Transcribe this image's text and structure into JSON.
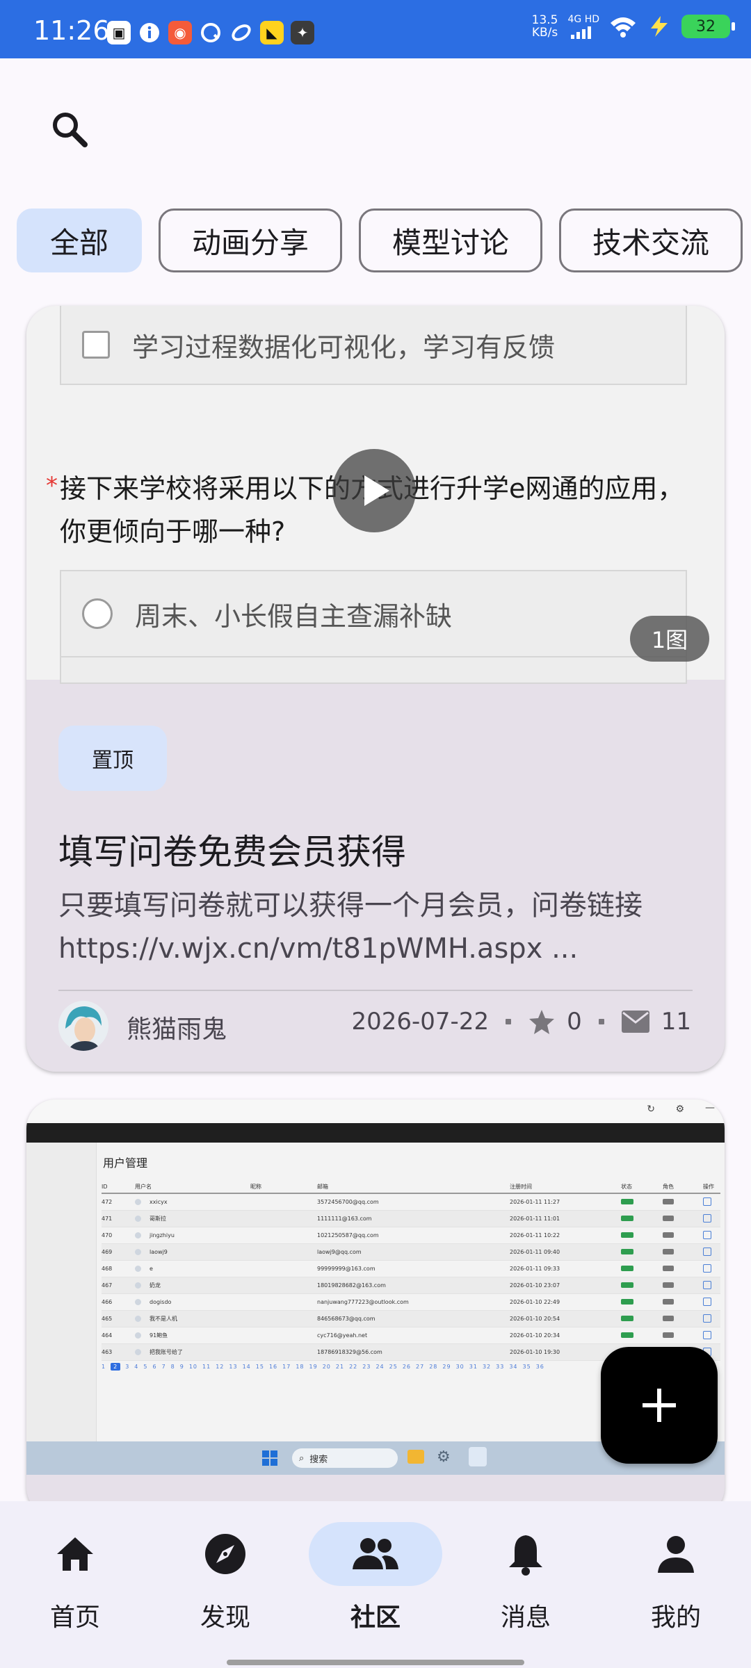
{
  "status_bar": {
    "time": "11:26",
    "net_speed_value": "13.5",
    "net_speed_unit": "KB/s",
    "network": "4G HD",
    "battery": "32"
  },
  "tabs": [
    "全部",
    "动画分享",
    "模型讨论",
    "技术交流"
  ],
  "post1": {
    "option_text_1": "学习过程数据化可视化，学习有反馈",
    "question_text": "接下来学校将采用以下的方式进行升学e网通的应用，你更倾向于哪一种?",
    "option_text_2": "周末、小长假自主查漏补缺",
    "image_count": "1图",
    "pin_label": "置顶",
    "title": "填写问卷免费会员获得",
    "body": "只要填写问卷就可以获得一个月会员，问卷链接https://v.wjx.cn/vm/t81pWMH.aspx ...",
    "author": "熊猫雨鬼",
    "date": "2026-07-22",
    "stars": "0",
    "comments": "11"
  },
  "post2": {
    "screenshot": {
      "page_title": "用户管理",
      "columns": [
        "ID",
        "用户名",
        "昵称",
        "邮箱",
        "注册时间",
        "状态",
        "角色",
        "操作"
      ],
      "rows": [
        {
          "id": "472",
          "user": "xxicyx",
          "mail": "3572456700@qq.com",
          "time": "2026-01-11 11:27"
        },
        {
          "id": "471",
          "user": "哥斯拉",
          "mail": "1111111@163.com",
          "time": "2026-01-11 11:01"
        },
        {
          "id": "470",
          "user": "jingzhiyu",
          "mail": "1021250587@qq.com",
          "time": "2026-01-11 10:22"
        },
        {
          "id": "469",
          "user": "laowj9",
          "mail": "laowj9@qq.com",
          "time": "2026-01-11 09:40"
        },
        {
          "id": "468",
          "user": "e",
          "mail": "99999999@163.com",
          "time": "2026-01-11 09:33"
        },
        {
          "id": "467",
          "user": "奶龙",
          "mail": "18019828682@163.com",
          "time": "2026-01-10 23:07"
        },
        {
          "id": "466",
          "user": "dogisdo",
          "mail": "nanjuwang777223@outlook.com",
          "time": "2026-01-10 22:49"
        },
        {
          "id": "465",
          "user": "我不是人机",
          "mail": "846568673@qq.com",
          "time": "2026-01-10 20:54"
        },
        {
          "id": "464",
          "user": "91鲍鱼",
          "mail": "cyc716@yeah.net",
          "time": "2026-01-10 20:34"
        },
        {
          "id": "463",
          "user": "把我账号给了",
          "mail": "18786918329@56.com",
          "time": "2026-01-10 19:30"
        }
      ],
      "pages": [
        "1",
        "2",
        "3",
        "4",
        "5",
        "6",
        "7",
        "8",
        "9",
        "10",
        "11",
        "12",
        "13",
        "14",
        "15",
        "16",
        "17",
        "18",
        "19",
        "20",
        "21",
        "22",
        "23",
        "24",
        "25",
        "26",
        "27",
        "28",
        "29",
        "30",
        "31",
        "32",
        "33",
        "34",
        "35",
        "36"
      ],
      "current_page": "2",
      "search_label": "搜索"
    }
  },
  "nav": [
    {
      "label": "首页",
      "icon": "home-icon"
    },
    {
      "label": "发现",
      "icon": "compass-icon"
    },
    {
      "label": "社区",
      "icon": "community-icon"
    },
    {
      "label": "消息",
      "icon": "bell-icon"
    },
    {
      "label": "我的",
      "icon": "person-icon"
    }
  ],
  "colors": {
    "status_bar": "#2c6ee3",
    "accent": "#d5e3fc",
    "card": "#e6e0e9"
  }
}
